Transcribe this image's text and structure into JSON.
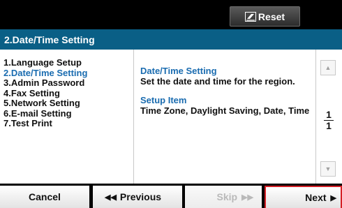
{
  "header": {
    "reset_label": "Reset",
    "title": "2.Date/Time Setting"
  },
  "menu": {
    "items": [
      "1.Language Setup",
      "2.Date/Time Setting",
      "3.Admin Password",
      "4.Fax Setting",
      "5.Network Setting",
      "6.E-mail Setting",
      "7.Test Print"
    ]
  },
  "detail": {
    "heading": "Date/Time Setting",
    "description": "Set the date and time for the region.",
    "setup_heading": "Setup Item",
    "setup_items": "Time Zone, Daylight Saving, Date, Time"
  },
  "pager": {
    "current": "1",
    "total": "1"
  },
  "buttons": {
    "cancel": "Cancel",
    "previous": "Previous",
    "skip": "Skip",
    "next": "Next"
  },
  "icons": {
    "reset": "eraser-icon",
    "up": "triangle-up-icon",
    "down": "triangle-down-icon",
    "previous": "double-chevron-left-icon",
    "skip": "double-chevron-right-icon",
    "next": "triangle-right-icon"
  },
  "colors": {
    "title_bar": "#0a5f86",
    "accent_text": "#1a6cb0",
    "next_highlight": "#d51f26"
  }
}
